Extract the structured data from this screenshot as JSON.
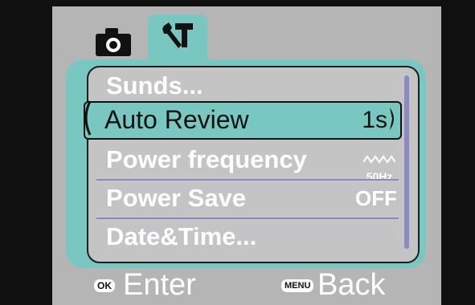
{
  "tabs": [
    {
      "icon": "camera-icon",
      "active": false
    },
    {
      "icon": "tools-icon",
      "active": true
    }
  ],
  "menu": {
    "items": [
      {
        "label": "Sunds...",
        "value": ""
      },
      {
        "label": "Auto Review",
        "value": "1s",
        "selected": true
      },
      {
        "label": "Power frequency",
        "value": "50Hz"
      },
      {
        "label": "Power Save",
        "value": "OFF"
      },
      {
        "label": "Date&Time...",
        "value": ""
      }
    ]
  },
  "footer": {
    "ok_badge": "OK",
    "enter_label": "Enter",
    "menu_badge": "MENU",
    "back_label": "Back"
  },
  "colors": {
    "accent": "#78c7c0",
    "background": "#b5b5b5",
    "list_bg": "#c4c4c4",
    "separator": "#8a8ac4"
  }
}
